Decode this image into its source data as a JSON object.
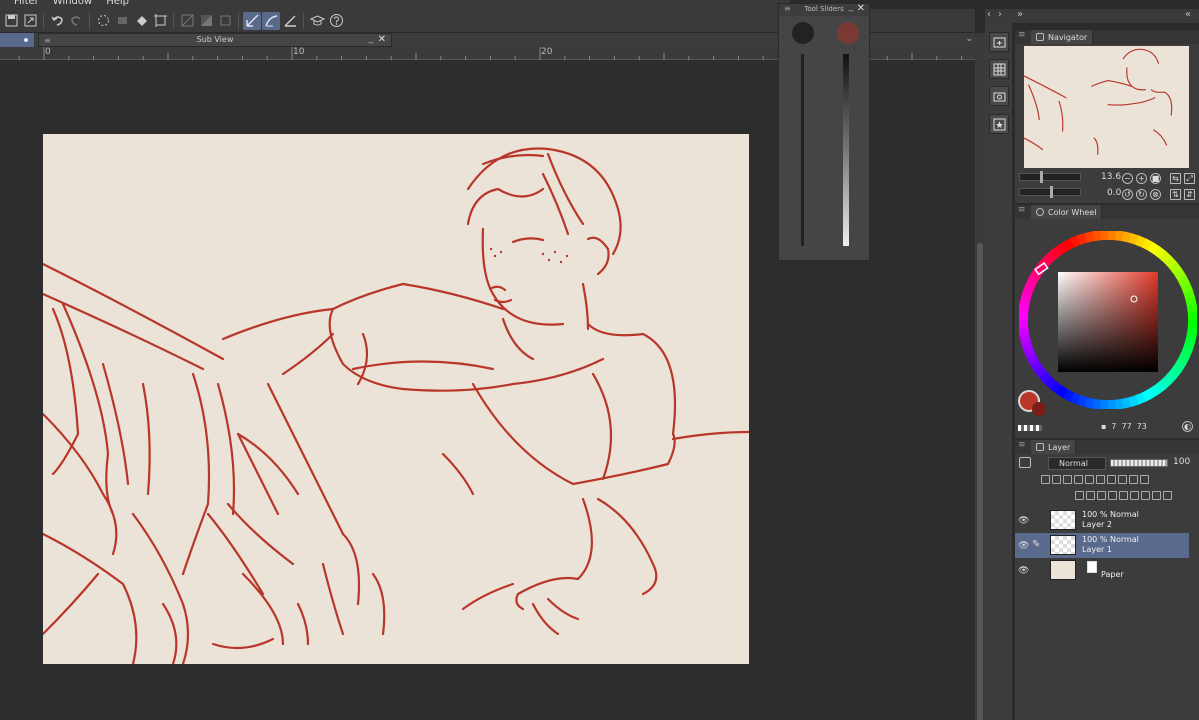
{
  "menu": {
    "items": [
      "Filter",
      "Window",
      "Help"
    ]
  },
  "subview": {
    "title": "Sub View"
  },
  "ruler": {
    "labels": [
      "0",
      "10",
      "20"
    ]
  },
  "tool_sliders": {
    "title": "Tool Sliders"
  },
  "navigator": {
    "tab_label": "Navigator",
    "zoom": "13.6",
    "rotation": "0.0"
  },
  "color_wheel": {
    "tab_label": "Color Wheel",
    "main_color": "#b9362a",
    "sub_color": "#7a1e17",
    "h": "7",
    "s": "77",
    "v": "73"
  },
  "layer_panel": {
    "tab_label": "Layer",
    "blend_mode": "Normal",
    "opacity": "100",
    "layers": [
      {
        "info": "100 % Normal",
        "name": "Layer 2",
        "selected": false
      },
      {
        "info": "100 % Normal",
        "name": "Layer 1",
        "selected": true
      },
      {
        "name": "Paper"
      }
    ]
  },
  "colors": {
    "accent": "#5a6a8c",
    "paper": "#ece3d8",
    "line": "#b9362a"
  }
}
